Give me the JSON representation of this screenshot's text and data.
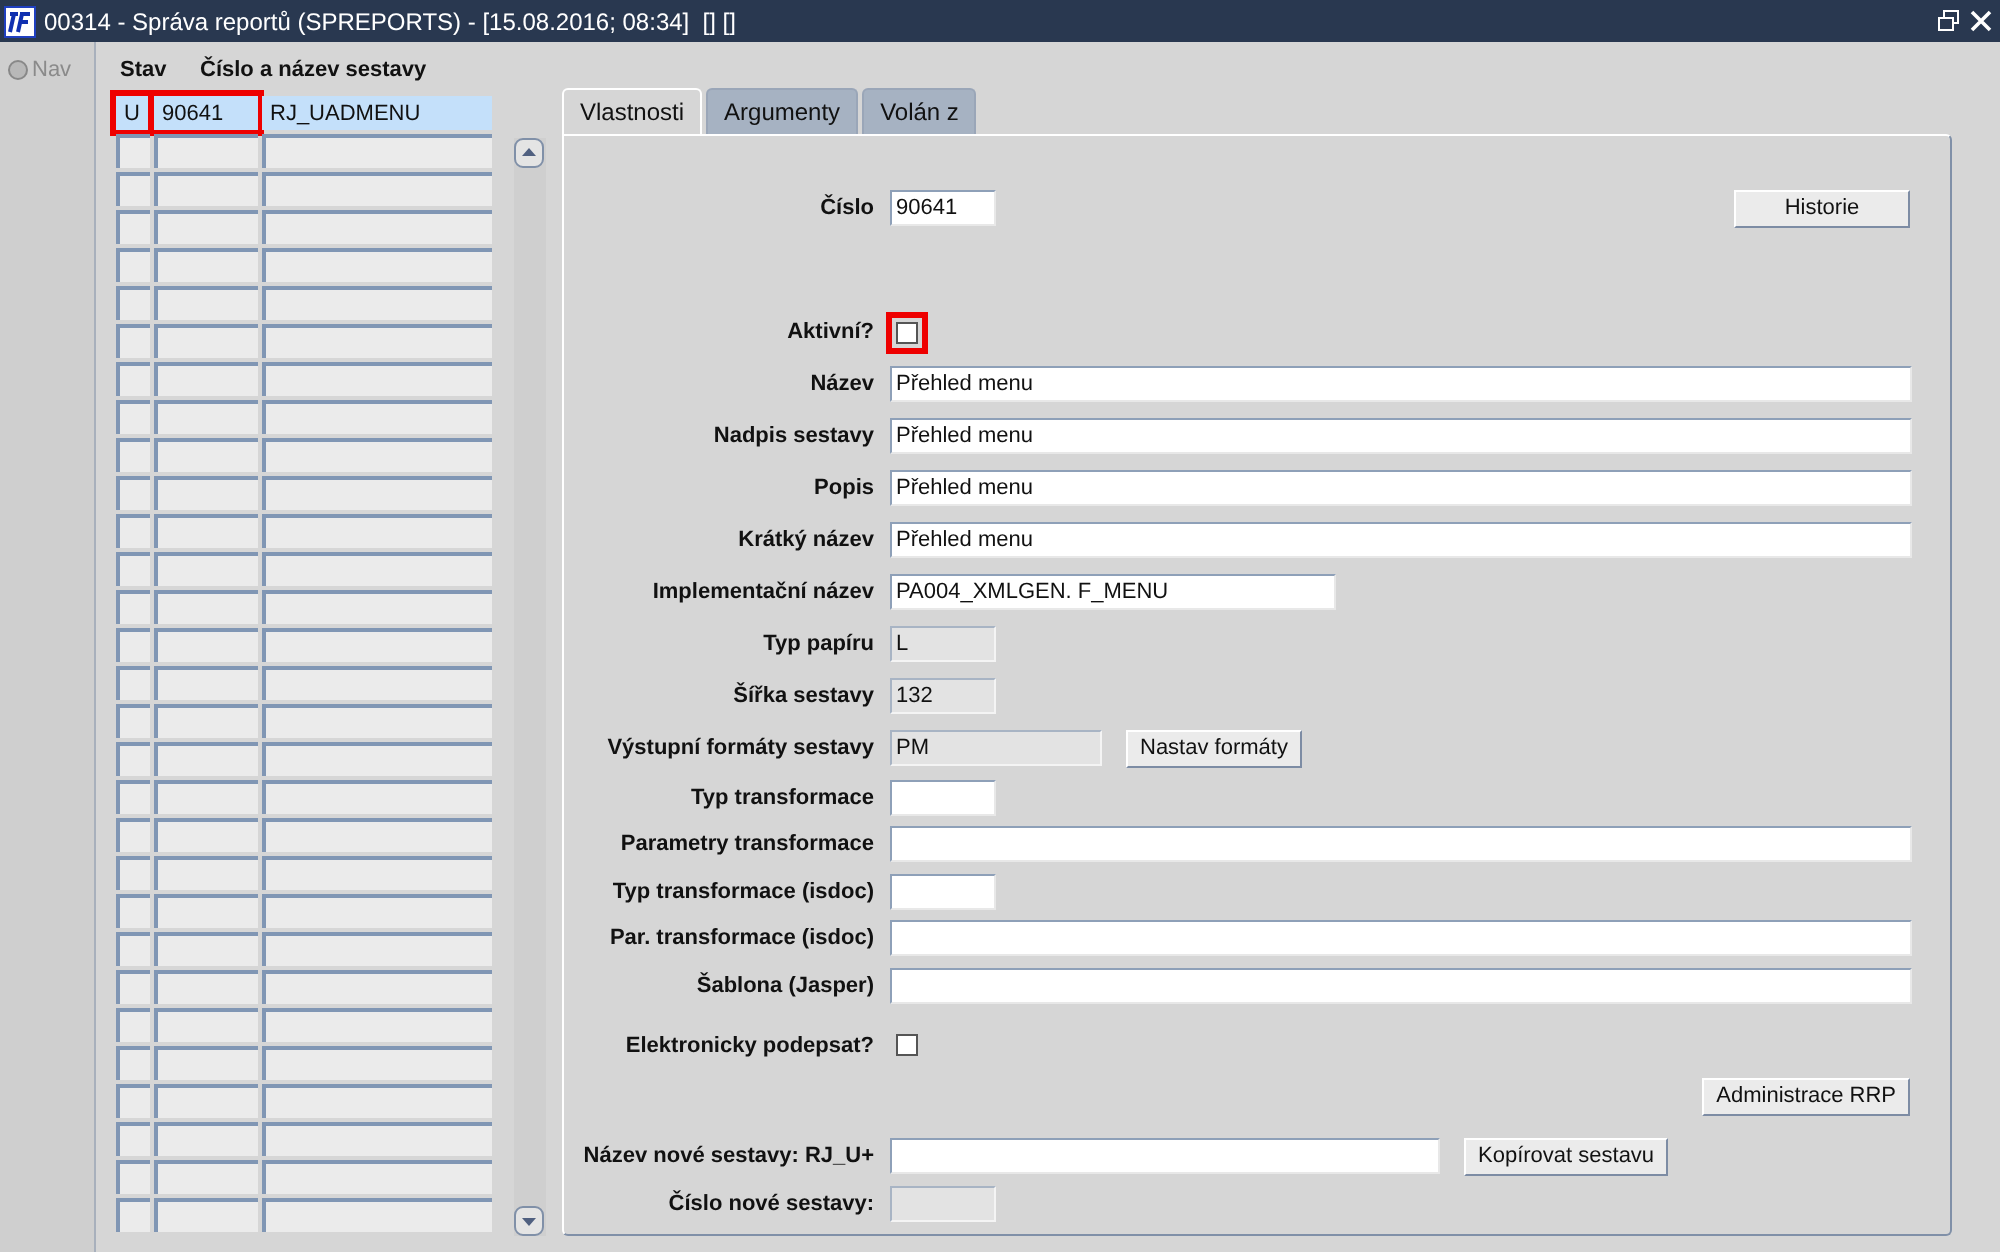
{
  "window": {
    "title": "00314 - Správa reportů (SPREPORTS) - [15.08.2016; 08:34]  [] []"
  },
  "nav": {
    "label": "Nav",
    "disabled": true
  },
  "list": {
    "columns": [
      "Stav",
      "Číslo a název sestavy"
    ],
    "rows": [
      {
        "status": "U",
        "number": "90641",
        "name": "RJ_UADMENU",
        "selected": true,
        "highlighted": true
      }
    ]
  },
  "tabs": [
    {
      "label": "Vlastnosti",
      "selected": true
    },
    {
      "label": "Argumenty",
      "selected": false
    },
    {
      "label": "Volán z",
      "selected": false
    }
  ],
  "form": {
    "rows": [
      {
        "kind": "text",
        "label": "Číslo",
        "value": "90641",
        "readonly": false,
        "button": "Historie"
      },
      {
        "kind": "checkbox",
        "label": "Aktivní?",
        "checked": false,
        "highlighted": true
      },
      {
        "kind": "text",
        "label": "Název",
        "value": "Přehled menu",
        "readonly": false
      },
      {
        "kind": "text",
        "label": "Nadpis sestavy",
        "value": "Přehled menu",
        "readonly": false
      },
      {
        "kind": "text",
        "label": "Popis",
        "value": "Přehled menu",
        "readonly": false
      },
      {
        "kind": "text",
        "label": "Krátký název",
        "value": "Přehled menu",
        "readonly": false
      },
      {
        "kind": "text",
        "label": "Implementační název",
        "value": "PA004_XMLGEN. F_MENU",
        "readonly": false
      },
      {
        "kind": "text",
        "label": "Typ papíru",
        "value": "L",
        "readonly": true
      },
      {
        "kind": "text",
        "label": "Šířka sestavy",
        "value": "132",
        "readonly": true
      },
      {
        "kind": "text",
        "label": "Výstupní formáty sestavy",
        "value": "PM",
        "readonly": true,
        "button": "Nastav formáty"
      },
      {
        "kind": "text",
        "label": "Typ transformace",
        "readonly": false
      },
      {
        "kind": "text",
        "label": "Parametry transformace",
        "readonly": false
      },
      {
        "kind": "text",
        "label": "Typ transformace (isdoc)",
        "readonly": false
      },
      {
        "kind": "text",
        "label": "Par. transformace (isdoc)",
        "readonly": false
      },
      {
        "kind": "text",
        "label": "Šablona (Jasper)",
        "readonly": false
      },
      {
        "kind": "checkbox",
        "label": "Elektronicky podepsat?",
        "checked": false,
        "highlighted": false
      },
      {
        "kind": "button",
        "button": "Administrace RRP"
      },
      {
        "kind": "text",
        "label": "Název nové sestavy: RJ_U+",
        "readonly": false,
        "button": "Kopírovat sestavu"
      },
      {
        "kind": "text",
        "label": "Číslo nové sestavy:",
        "readonly": true
      }
    ]
  }
}
